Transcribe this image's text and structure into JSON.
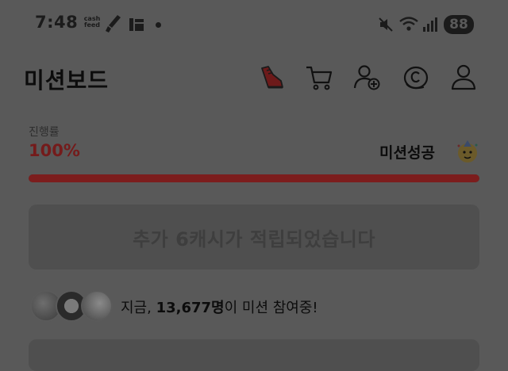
{
  "status_bar": {
    "time": "7:48",
    "cash_icon_line1": "cash",
    "cash_icon_line2": "feed",
    "battery": "88",
    "icons": [
      "cashfeed-icon",
      "brush-icon",
      "news-icon",
      "notification-dot",
      "mute-icon",
      "wifi-icon",
      "signal-icon",
      "battery-icon"
    ]
  },
  "header": {
    "title": "미션보드",
    "icons": [
      "shoe-icon",
      "cart-icon",
      "add-friend-icon",
      "coin-icon",
      "profile-icon"
    ]
  },
  "progress": {
    "label": "진행률",
    "value_text": "100%",
    "fraction": 1.0,
    "status_text": "미션성공",
    "status_emoji": "party-face-icon"
  },
  "reward": {
    "text": "추가 6캐시가 적립되었습니다"
  },
  "participants": {
    "prefix": "지금, ",
    "count": "13,677명",
    "suffix": "이 미션 참여중!"
  },
  "colors": {
    "accent": "#741b1b",
    "background": "#595959"
  }
}
